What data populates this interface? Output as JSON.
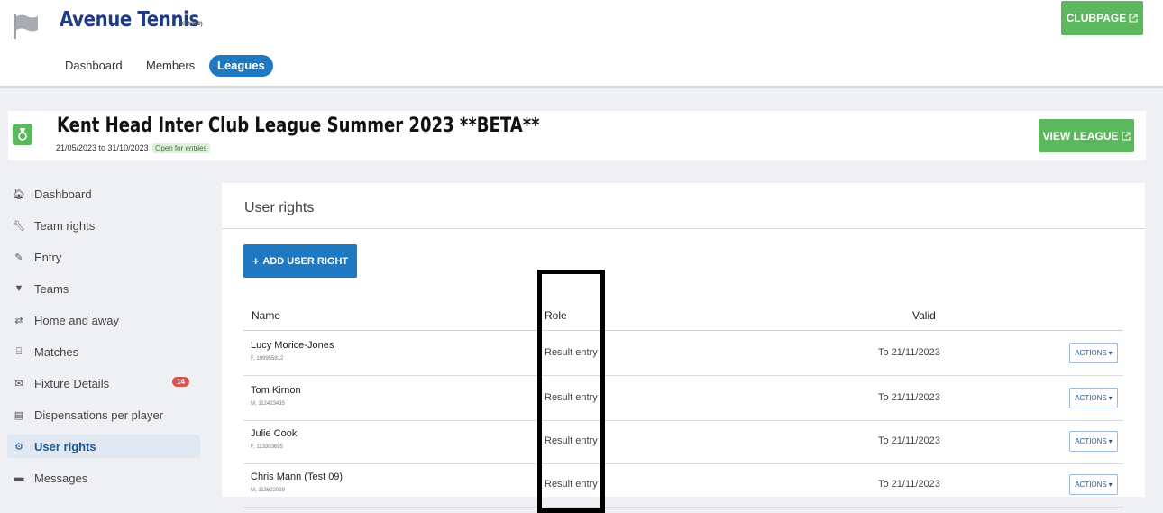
{
  "header": {
    "club_name": "Avenue Tennis",
    "club_code": "(KEN300)",
    "clubpage_label": "CLUBPAGE",
    "tabs": [
      {
        "label": "Dashboard",
        "active": false
      },
      {
        "label": "Members",
        "active": false
      },
      {
        "label": "Leagues",
        "active": true
      }
    ]
  },
  "league": {
    "title": "Kent Head Inter Club League Summer 2023 **BETA**",
    "dates": "21/05/2023 to 31/10/2023",
    "status": "Open for entries",
    "view_label": "VIEW LEAGUE"
  },
  "sidebar": {
    "items": [
      {
        "label": "Dashboard",
        "icon": "home-icon"
      },
      {
        "label": "Team rights",
        "icon": "wrench-icon"
      },
      {
        "label": "Entry",
        "icon": "pencil-icon"
      },
      {
        "label": "Teams",
        "icon": "shirt-icon"
      },
      {
        "label": "Home and away",
        "icon": "swap-icon"
      },
      {
        "label": "Matches",
        "icon": "list-icon"
      },
      {
        "label": "Fixture Details",
        "icon": "envelope-icon",
        "badge": "14"
      },
      {
        "label": "Dispensations per player",
        "icon": "id-card-icon"
      },
      {
        "label": "User rights",
        "icon": "gear-icon",
        "active": true
      },
      {
        "label": "Messages",
        "icon": "comment-icon"
      }
    ]
  },
  "main": {
    "title": "User rights",
    "add_label": "ADD USER RIGHT",
    "columns": {
      "name": "Name",
      "role": "Role",
      "valid": "Valid"
    },
    "rows": [
      {
        "name": "Lucy Morice-Jones",
        "sub": "F, 109955812",
        "role": "Result entry",
        "valid": "To 21/11/2023",
        "action": "ACTIONS"
      },
      {
        "name": "Tom Kirnon",
        "sub": "M, 112423435",
        "role": "Result entry",
        "valid": "To 21/11/2023",
        "action": "ACTIONS"
      },
      {
        "name": "Julie Cook",
        "sub": "F, 113303695",
        "role": "Result entry",
        "valid": "To 21/11/2023",
        "action": "ACTIONS"
      },
      {
        "name": "Chris Mann (Test 09)",
        "sub": "M, 113602029",
        "role": "Result entry",
        "valid": "To 21/11/2023",
        "action": "ACTIONS"
      }
    ]
  },
  "colors": {
    "primary": "#1e78c2",
    "success": "#5cb85c",
    "badge": "#d9534f",
    "club_name": "#1e3a8a"
  }
}
